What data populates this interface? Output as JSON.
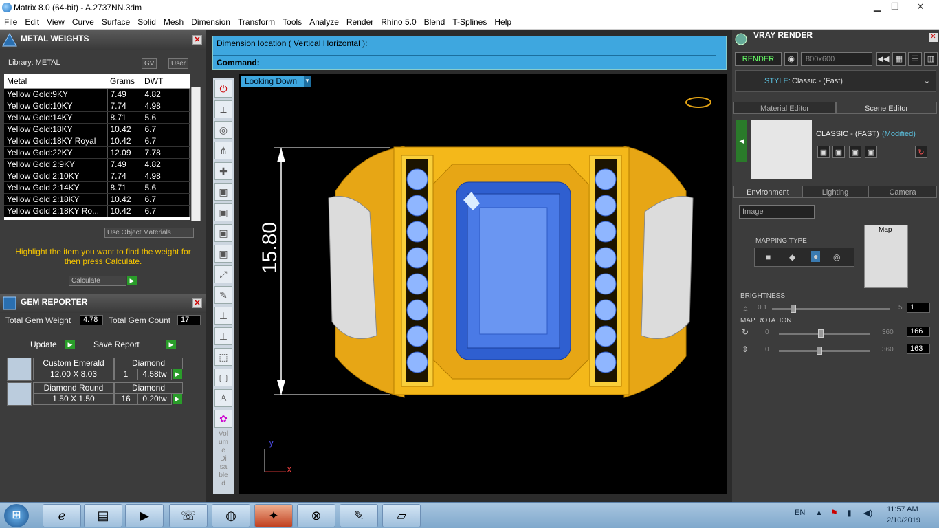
{
  "window": {
    "title": "Matrix 8.0 (64-bit) - A.2737NN.3dm",
    "min": "▁",
    "max": "❐",
    "close": "✕"
  },
  "menu": [
    "File",
    "Edit",
    "View",
    "Curve",
    "Surface",
    "Solid",
    "Mesh",
    "Dimension",
    "Transform",
    "Tools",
    "Analyze",
    "Render",
    "Rhino 5.0",
    "Blend",
    "T-Splines",
    "Help"
  ],
  "metal": {
    "title": "METAL WEIGHTS",
    "library": "Library: METAL",
    "gv": "GV",
    "user": "User",
    "columns": [
      "Metal",
      "Grams",
      "DWT"
    ],
    "rows": [
      [
        "Yellow Gold:9KY",
        "7.49",
        "4.82"
      ],
      [
        "Yellow Gold:10KY",
        "7.74",
        "4.98"
      ],
      [
        "Yellow Gold:14KY",
        "8.71",
        "5.6"
      ],
      [
        "Yellow Gold:18KY",
        "10.42",
        "6.7"
      ],
      [
        "Yellow Gold:18KY Royal",
        "10.42",
        "6.7"
      ],
      [
        "Yellow Gold:22KY",
        "12.09",
        "7.78"
      ],
      [
        "Yellow Gold 2:9KY",
        "7.49",
        "4.82"
      ],
      [
        "Yellow Gold 2:10KY",
        "7.74",
        "4.98"
      ],
      [
        "Yellow Gold 2:14KY",
        "8.71",
        "5.6"
      ],
      [
        "Yellow Gold 2:18KY",
        "10.42",
        "6.7"
      ],
      [
        "Yellow Gold 2:18KY Ro...",
        "10.42",
        "6.7"
      ]
    ],
    "use_object_materials": "Use Object Materials",
    "hint": "Highlight the item you want to find the weight for then press Calculate.",
    "calculate": "Calculate"
  },
  "gem": {
    "title": "GEM REPORTER",
    "total_weight_label": "Total Gem Weight",
    "total_weight": "4.78",
    "total_count_label": "Total Gem Count",
    "total_count": "17",
    "update": "Update",
    "save_report": "Save Report",
    "items": [
      {
        "shape": "Custom Emerald",
        "type": "Diamond",
        "size": "12.00 X 8.03",
        "count": "1",
        "weight": "4.58tw"
      },
      {
        "shape": "Diamond Round",
        "type": "Diamond",
        "size": "1.50 X 1.50",
        "count": "16",
        "weight": "0.20tw"
      }
    ]
  },
  "command": {
    "line1": "Dimension location ( Vertical  Horizontal ):",
    "prompt": "Command:"
  },
  "viewport": {
    "label": "Looking Down",
    "dimension": "15.80",
    "axis_y": "y",
    "axis_x": "x"
  },
  "viewtools": {
    "disabled_text": "Volume Disabled"
  },
  "vray": {
    "title": "VRAY RENDER",
    "render": "RENDER",
    "resolution": "800x600",
    "style_label": "STYLE:",
    "style_value": "Classic - (Fast)",
    "tabs": [
      "Material Editor",
      "Scene Editor"
    ],
    "scene_name": "CLASSIC - (FAST)",
    "modified": "(Modified)",
    "env_tabs": [
      "Environment",
      "Lighting",
      "Camera"
    ],
    "image_select": "Image",
    "map_label": "Map",
    "mapping_type": "MAPPING TYPE",
    "brightness": "BRIGHTNESS",
    "brightness_min": "0.1",
    "brightness_max": "5",
    "brightness_value": "1",
    "map_rotation": "MAP ROTATION",
    "rot1_min": "0",
    "rot1_max": "360",
    "rot1_value": "166",
    "rot2_min": "0",
    "rot2_max": "360",
    "rot2_value": "163",
    "brightness_level": 0.18,
    "rot1_level": 0.46,
    "rot2_level": 0.45
  },
  "taskbar": {
    "lang": "EN",
    "time": "11:57 AM",
    "date": "2/10/2019"
  }
}
